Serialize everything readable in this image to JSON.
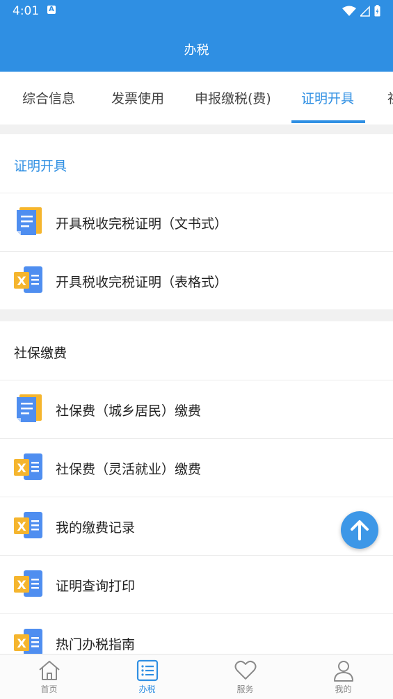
{
  "status_bar": {
    "time": "4:01",
    "notification_badge": "A"
  },
  "app_bar": {
    "title": "办税"
  },
  "tabs": [
    {
      "label": "综合信息"
    },
    {
      "label": "发票使用"
    },
    {
      "label": "申报缴税(费)"
    },
    {
      "label": "证明开具",
      "active": true
    },
    {
      "label": "社"
    }
  ],
  "sections": [
    {
      "title": "证明开具",
      "title_color": "#2f8fe3",
      "items": [
        {
          "label": "开具税收完税证明（文书式）",
          "icon": "document-icon"
        },
        {
          "label": "开具税收完税证明（表格式）",
          "icon": "excel-icon"
        }
      ]
    },
    {
      "title": "社保缴费",
      "title_color": "#222222",
      "items": [
        {
          "label": "社保费（城乡居民）缴费",
          "icon": "document-icon"
        },
        {
          "label": "社保费（灵活就业）缴费",
          "icon": "excel-icon"
        },
        {
          "label": "我的缴费记录",
          "icon": "excel-icon"
        },
        {
          "label": "证明查询打印",
          "icon": "excel-icon"
        },
        {
          "label": "热门办税指南",
          "icon": "excel-icon"
        }
      ]
    }
  ],
  "bottom_nav": [
    {
      "label": "首页",
      "icon": "home-icon"
    },
    {
      "label": "办税",
      "icon": "list-icon",
      "active": true
    },
    {
      "label": "服务",
      "icon": "heart-icon"
    },
    {
      "label": "我的",
      "icon": "person-icon"
    }
  ],
  "colors": {
    "primary": "#2f8fe3",
    "fab": "#3d97e7"
  }
}
